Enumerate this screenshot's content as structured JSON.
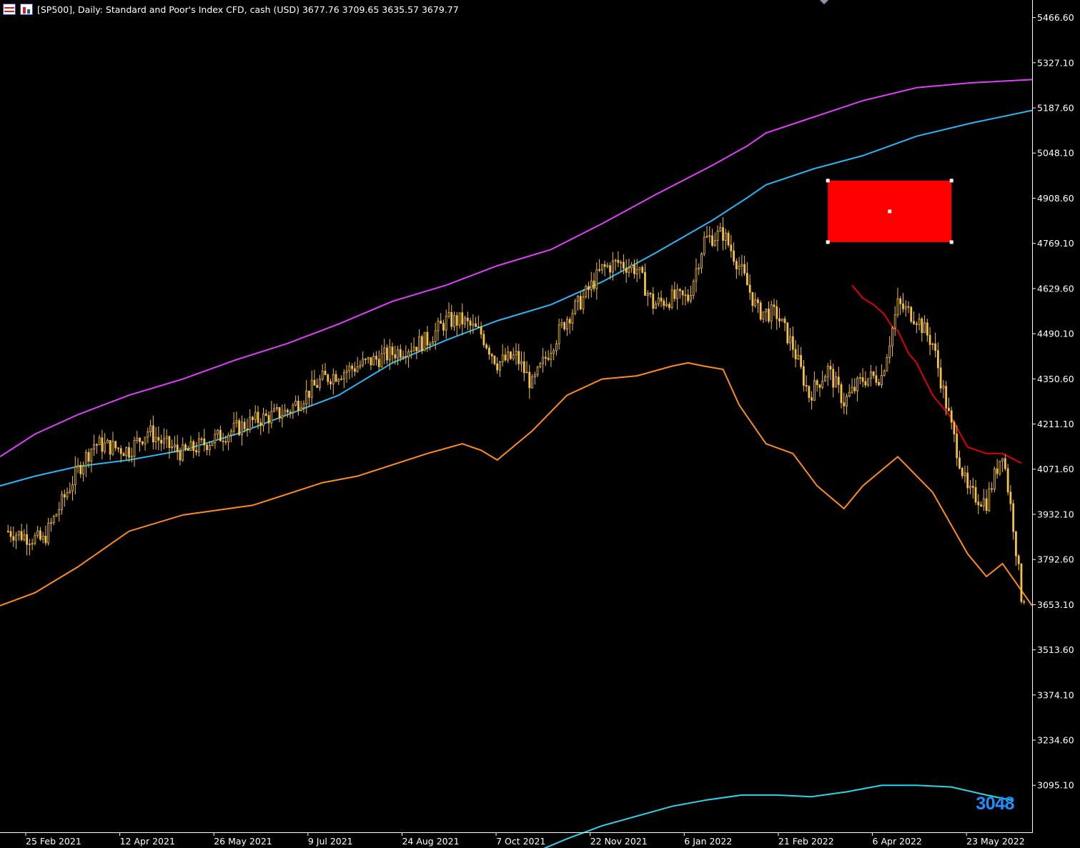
{
  "header": {
    "title": "[SP500], Daily:  Standard and Poor's Index CFD, cash (USD)  3677.76 3709.65 3635.57 3679.77",
    "icons": [
      "chart-grid-icon",
      "chart-bars-icon"
    ]
  },
  "price_tag": "3048",
  "colors": {
    "background": "#000000",
    "candle": "#f5c242",
    "magenta_line": "#e040fb",
    "blue_line": "#29b6f6",
    "orange_line": "#ff8c1a",
    "red_line": "#e00000",
    "cyan_line": "#29d7e8",
    "rectangle": "#ff0000",
    "axis": "#ffffff"
  },
  "chart_data": {
    "type": "line",
    "title": "[SP500], Daily:  Standard and Poor's Index CFD, cash (USD)  3677.76 3709.65 3635.57 3679.77",
    "ohlc": {
      "open": 3677.76,
      "high": 3709.65,
      "low": 3635.57,
      "close": 3679.77
    },
    "y_ticks": [
      "5466.60",
      "5327.10",
      "5187.60",
      "5048.10",
      "4908.60",
      "4769.10",
      "4629.60",
      "4490.10",
      "4350.60",
      "4211.10",
      "4071.60",
      "3932.10",
      "3792.60",
      "3653.10",
      "3513.60",
      "3374.10",
      "3234.60",
      "3095.10"
    ],
    "x_ticks": [
      "25 Feb 2021",
      "12 Apr 2021",
      "26 May 2021",
      "9 Jul 2021",
      "24 Aug 2021",
      "7 Oct 2021",
      "22 Nov 2021",
      "6 Jan 2022",
      "21 Feb 2022",
      "6 Apr 2022",
      "23 May 2022"
    ],
    "ylim": [
      2950,
      5490
    ],
    "xlim": [
      -3,
      381
    ],
    "grid": false,
    "series": [
      {
        "key": "price",
        "style": "candles",
        "x": [
          0,
          13,
          26,
          32,
          45,
          52,
          58,
          65,
          78,
          91,
          104,
          117,
          130,
          143,
          156,
          163,
          169,
          176,
          182,
          189,
          195,
          202,
          208,
          214,
          221,
          227,
          234,
          240,
          247,
          253,
          259,
          266,
          272,
          279,
          286,
          292,
          298,
          305,
          311,
          318,
          325,
          331,
          338,
          344,
          351,
          357,
          364,
          370,
          374,
          377
        ],
        "y": [
          3880,
          3850,
          4070,
          4150,
          4130,
          4190,
          4150,
          4120,
          4170,
          4220,
          4250,
          4350,
          4390,
          4430,
          4470,
          4530,
          4530,
          4490,
          4400,
          4420,
          4330,
          4450,
          4540,
          4600,
          4690,
          4710,
          4690,
          4580,
          4600,
          4600,
          4780,
          4800,
          4700,
          4560,
          4550,
          4450,
          4300,
          4380,
          4280,
          4350,
          4360,
          4580,
          4540,
          4460,
          4200,
          4000,
          3970,
          4130,
          3900,
          3680
        ]
      },
      {
        "key": "upper-envelope",
        "style": "line",
        "x": [
          -3,
          10,
          26,
          45,
          65,
          85,
          104,
          123,
          143,
          163,
          182,
          202,
          221,
          241,
          262,
          275,
          282,
          300,
          318,
          338,
          358,
          381
        ],
        "y": [
          4110,
          4180,
          4240,
          4300,
          4350,
          4410,
          4460,
          4520,
          4590,
          4640,
          4700,
          4750,
          4830,
          4920,
          5010,
          5070,
          5110,
          5160,
          5210,
          5250,
          5265,
          5275
        ]
      },
      {
        "key": "lower-envelope",
        "style": "line",
        "x": [
          -3,
          10,
          26,
          45,
          65,
          85,
          104,
          123,
          143,
          163,
          182,
          202,
          221,
          241,
          262,
          275,
          282,
          300,
          318,
          338,
          358,
          381
        ],
        "y": [
          4020,
          4050,
          4080,
          4100,
          4130,
          4180,
          4240,
          4300,
          4400,
          4470,
          4530,
          4580,
          4650,
          4740,
          4840,
          4910,
          4950,
          5000,
          5040,
          5100,
          5140,
          5180
        ]
      },
      {
        "key": "orange-average",
        "style": "line",
        "x": [
          -3,
          10,
          26,
          45,
          65,
          91,
          117,
          130,
          156,
          169,
          176,
          182,
          195,
          208,
          221,
          234,
          247,
          253,
          259,
          266,
          272,
          282,
          292,
          301,
          311,
          318,
          331,
          344,
          357,
          364,
          370,
          381
        ],
        "y": [
          3650,
          3690,
          3770,
          3880,
          3930,
          3960,
          4030,
          4050,
          4120,
          4150,
          4130,
          4100,
          4190,
          4300,
          4350,
          4360,
          4390,
          4400,
          4390,
          4380,
          4270,
          4150,
          4120,
          4020,
          3950,
          4020,
          4110,
          4000,
          3810,
          3740,
          3780,
          3650
        ]
      },
      {
        "key": "red-line",
        "style": "line",
        "x": [
          314,
          318,
          322,
          326,
          329,
          331,
          335,
          338,
          344,
          351,
          357,
          364,
          370,
          377
        ],
        "y": [
          4640,
          4600,
          4580,
          4550,
          4510,
          4500,
          4430,
          4400,
          4300,
          4230,
          4140,
          4120,
          4120,
          4090
        ]
      },
      {
        "key": "cyan-average",
        "style": "line",
        "x": [
          195,
          208,
          221,
          234,
          247,
          260,
          273,
          286,
          299,
          312,
          325,
          338,
          351,
          364,
          374
        ],
        "y": [
          2885,
          2930,
          2970,
          3000,
          3030,
          3050,
          3065,
          3065,
          3060,
          3075,
          3095,
          3095,
          3090,
          3065,
          3048
        ]
      }
    ],
    "rectangle": {
      "x": [
        305,
        351
      ],
      "y": [
        4773,
        4963
      ]
    }
  }
}
